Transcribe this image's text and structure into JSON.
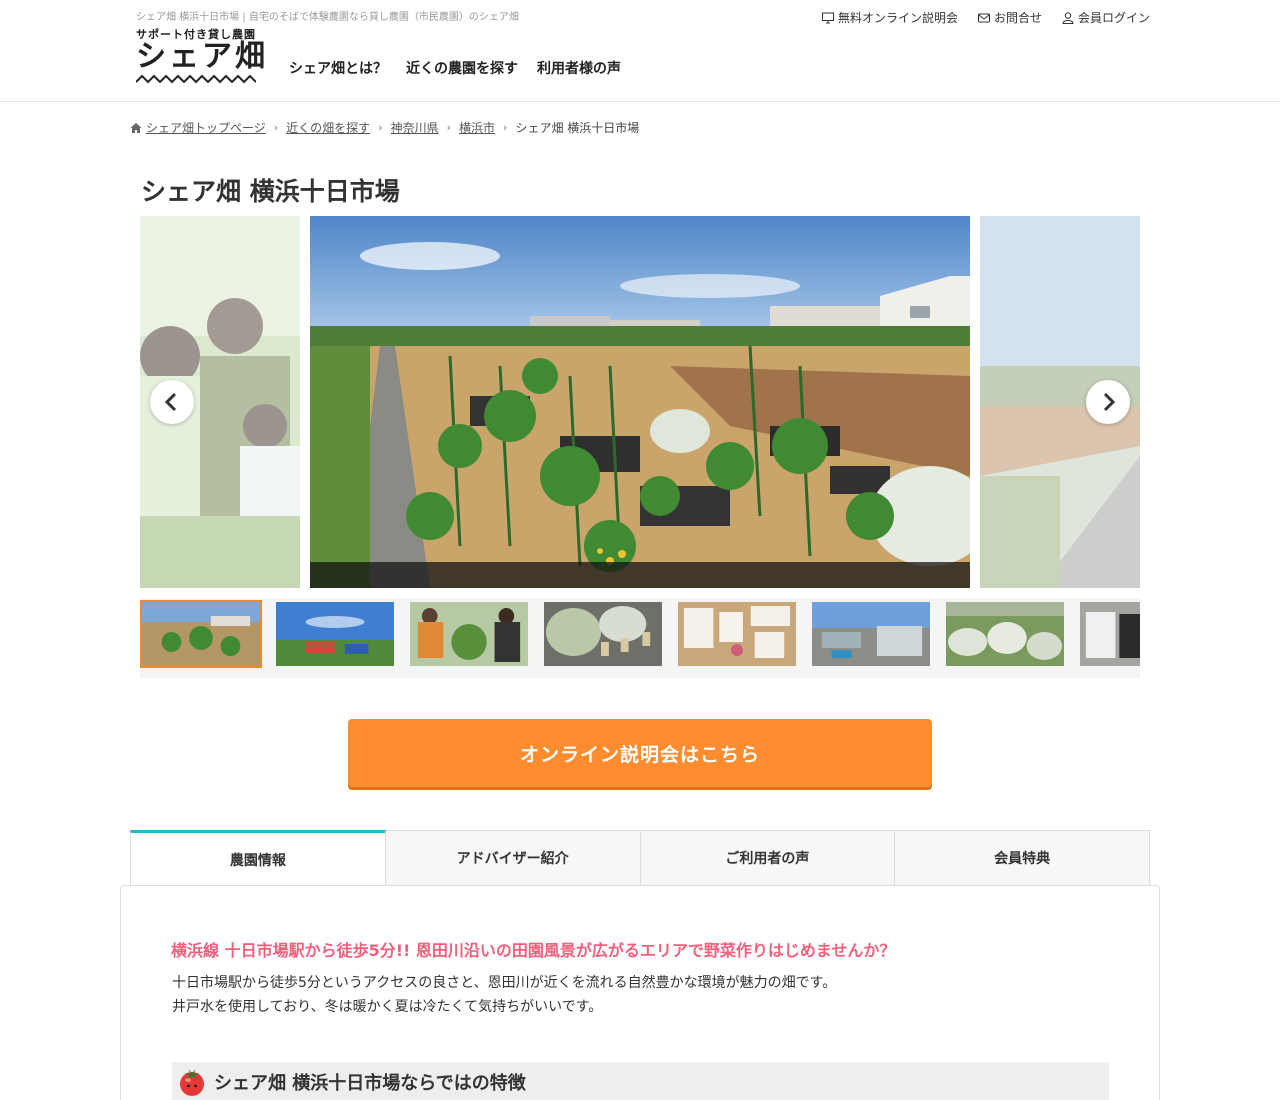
{
  "header": {
    "tagline": "シェア畑 横浜十日市場 | 自宅のそばで体験農園なら貸し農園（市民農園）のシェア畑",
    "logo_sub": "サポート付き貸し農園",
    "logo_main": "シェア畑",
    "nav": [
      "シェア畑とは？",
      "近くの農園を探す",
      "利用者様の声"
    ],
    "util_links": [
      {
        "label": "無料オンライン説明会",
        "icon": "monitor-icon"
      },
      {
        "label": "お問合せ",
        "icon": "mail-icon"
      },
      {
        "label": "会員ログイン",
        "icon": "user-icon"
      }
    ]
  },
  "breadcrumb": {
    "items": [
      "シェア畑トップページ",
      "近くの畑を探す",
      "神奈川県",
      "横浜市"
    ],
    "current": "シェア畑 横浜十日市場"
  },
  "page_title": "シェア畑 横浜十日市場",
  "carousel": {
    "thumbnail_count": 8,
    "active_index": 0
  },
  "cta": {
    "label": "オンライン説明会はこちら"
  },
  "tabs": [
    "農園情報",
    "アドバイザー紹介",
    "ご利用者の声",
    "会員特典"
  ],
  "active_tab": 0,
  "content": {
    "lead": "横浜線 十日市場駅から徒歩5分!! 恩田川沿いの田園風景が広がるエリアで野菜作りはじめませんか？",
    "body": [
      "十日市場駅から徒歩5分というアクセスの良さと、恩田川が近くを流れる自然豊かな環境が魅力の畑です。",
      "井戸水を使用しており、冬は暖かく夏は冷たくて気持ちがいいです。"
    ],
    "section_heading": "シェア畑 横浜十日市場ならではの特徴"
  },
  "colors": {
    "accent_orange": "#ff8c2e",
    "tab_active_border": "#29b6d4",
    "lead_pink": "#f2607d",
    "thumb_active": "#f0892e"
  }
}
